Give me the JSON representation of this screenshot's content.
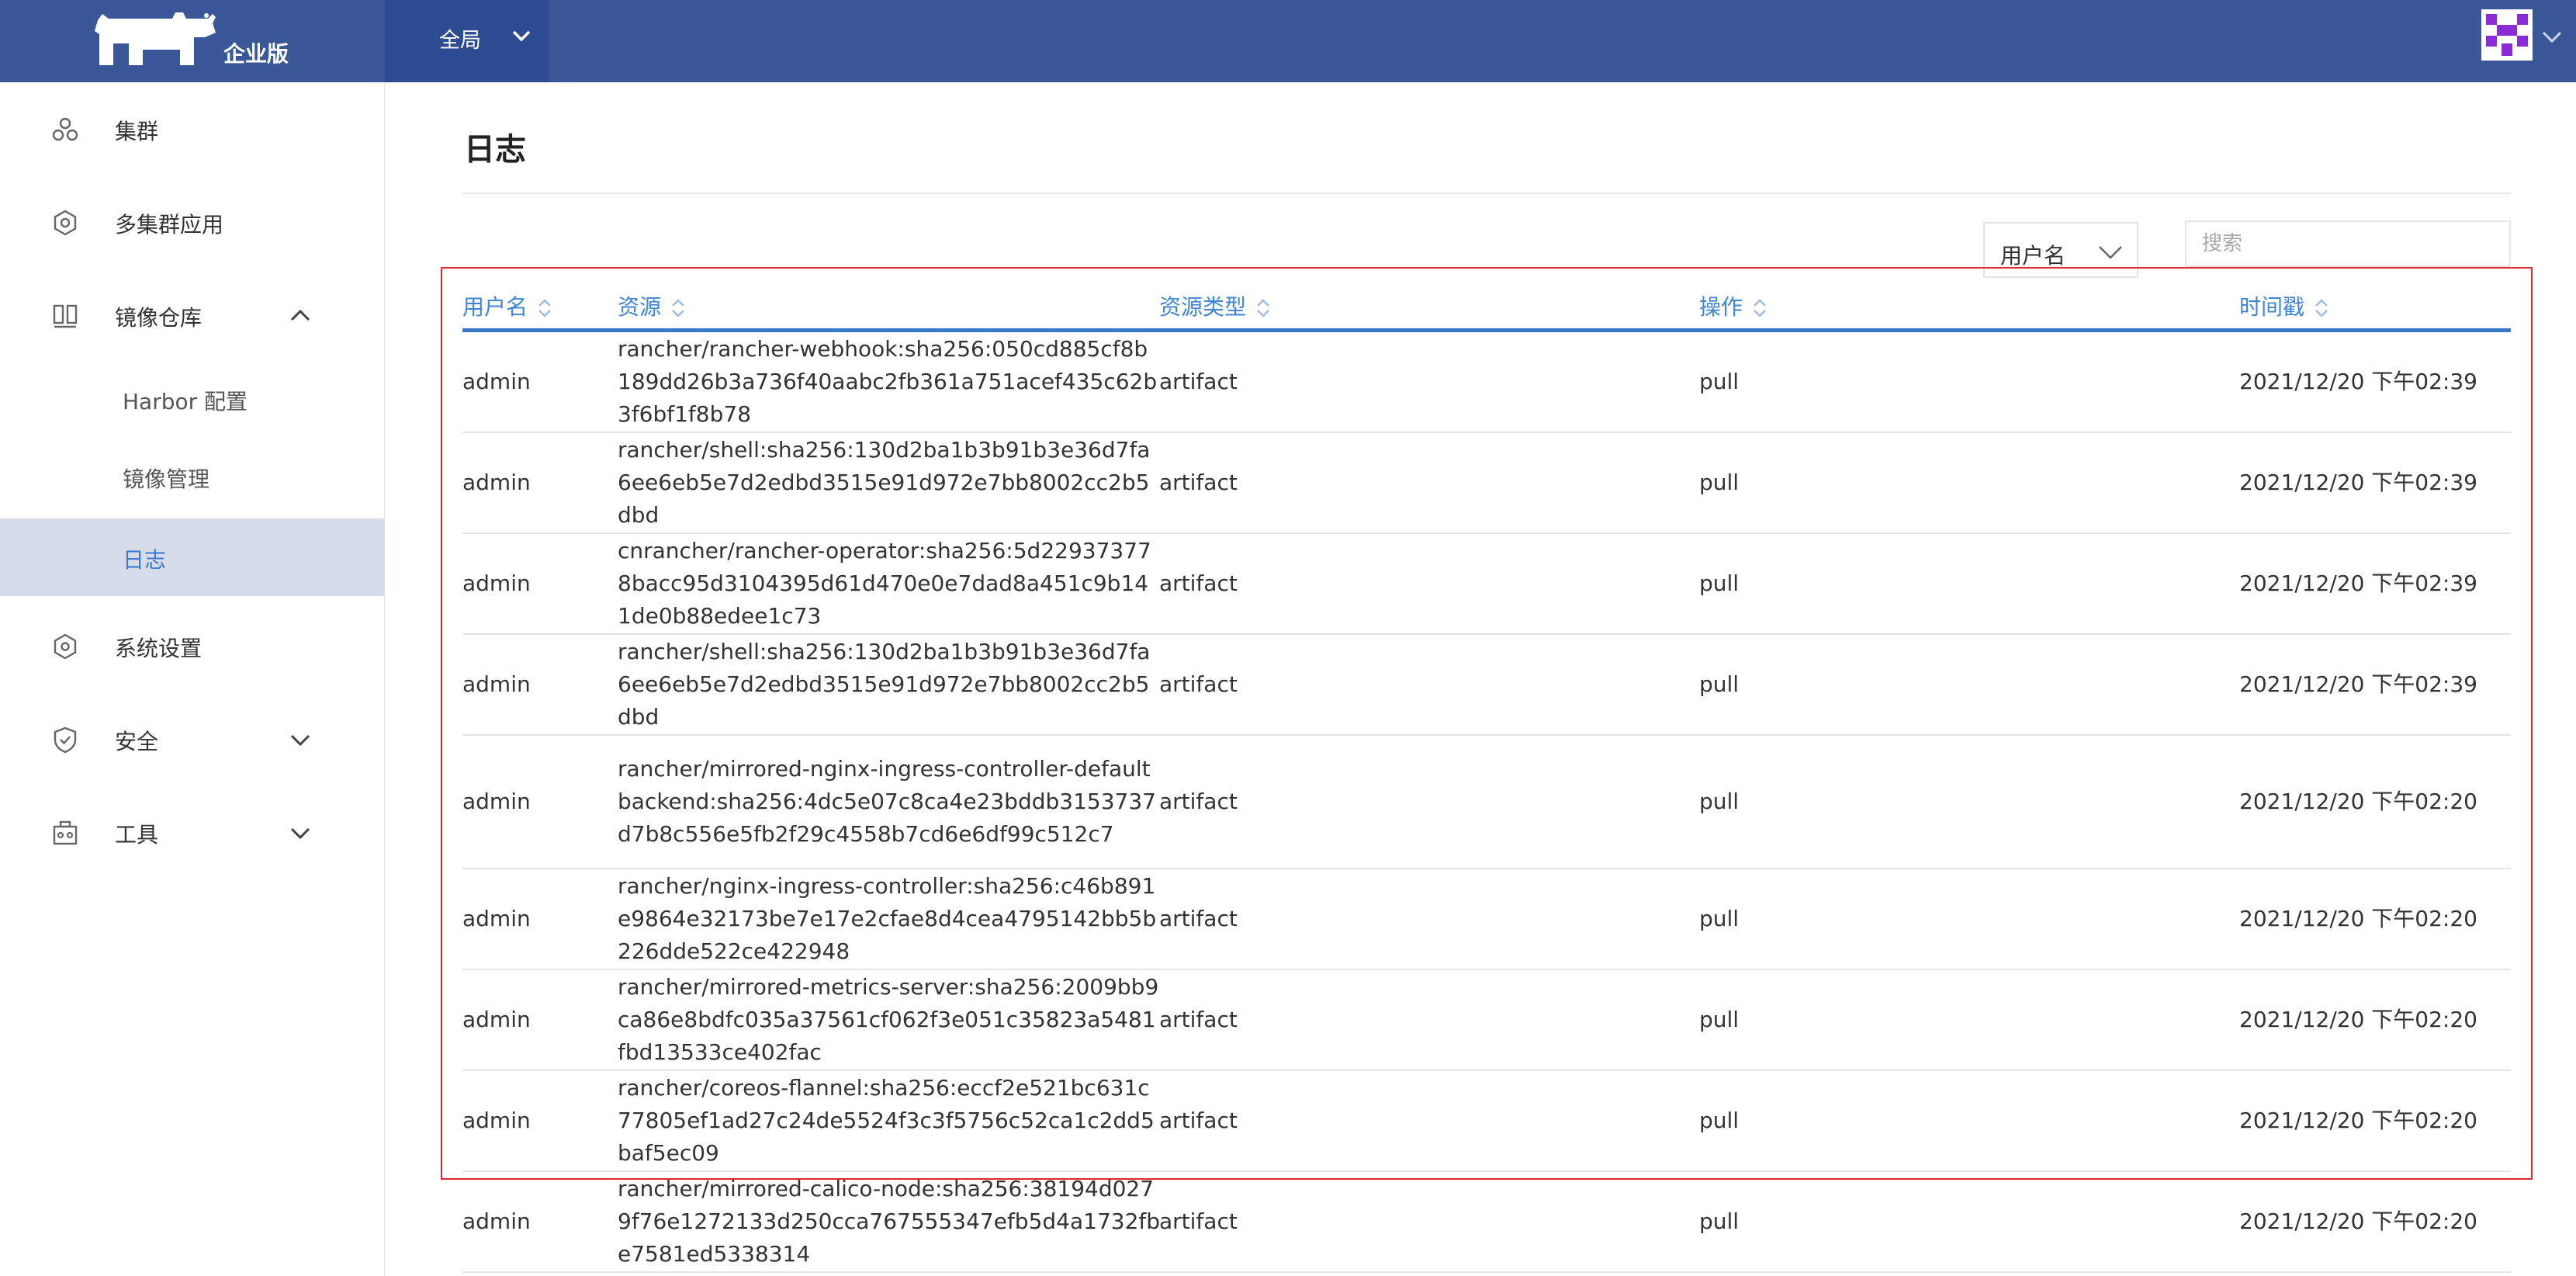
{
  "header": {
    "edition": "企业版",
    "scope_label": "全局"
  },
  "sidebar": {
    "items": [
      {
        "label": "集群"
      },
      {
        "label": "多集群应用"
      },
      {
        "label": "镜像仓库"
      },
      {
        "label": "系统设置"
      },
      {
        "label": "安全"
      },
      {
        "label": "工具"
      }
    ],
    "registry_subitems": [
      {
        "label": "Harbor 配置"
      },
      {
        "label": "镜像管理"
      },
      {
        "label": "日志",
        "active": true
      }
    ]
  },
  "page": {
    "title": "日志",
    "filter_value": "用户名",
    "search_placeholder": "搜索"
  },
  "table": {
    "columns": [
      "用户名",
      "资源",
      "资源类型",
      "操作",
      "时间戳"
    ],
    "rows": [
      {
        "user": "admin",
        "resource": "rancher/rancher-webhook:sha256:050cd885cf8b189dd26b3a736f40aabc2fb361a751acef435c62b3f6bf1f8b78",
        "type": "artifact",
        "op": "pull",
        "time": "2021/12/20 下午02:39"
      },
      {
        "user": "admin",
        "resource": "rancher/shell:sha256:130d2ba1b3b91b3e36d7fa6ee6eb5e7d2edbd3515e91d972e7bb8002cc2b5dbd",
        "type": "artifact",
        "op": "pull",
        "time": "2021/12/20 下午02:39"
      },
      {
        "user": "admin",
        "resource": "cnrancher/rancher-operator:sha256:5d229373778bacc95d3104395d61d470e0e7dad8a451c9b141de0b88edee1c73",
        "type": "artifact",
        "op": "pull",
        "time": "2021/12/20 下午02:39"
      },
      {
        "user": "admin",
        "resource": "rancher/shell:sha256:130d2ba1b3b91b3e36d7fa6ee6eb5e7d2edbd3515e91d972e7bb8002cc2b5dbd",
        "type": "artifact",
        "op": "pull",
        "time": "2021/12/20 下午02:39"
      },
      {
        "user": "admin",
        "resource": "rancher/mirrored-nginx-ingress-controller-defaultbackend:sha256:4dc5e07c8ca4e23bddb3153737d7b8c556e5fb2f29c4558b7cd6e6df99c512c7",
        "type": "artifact",
        "op": "pull",
        "time": "2021/12/20 下午02:20"
      },
      {
        "user": "admin",
        "resource": "rancher/nginx-ingress-controller:sha256:c46b891e9864e32173be7e17e2cfae8d4cea4795142bb5b226dde522ce422948",
        "type": "artifact",
        "op": "pull",
        "time": "2021/12/20 下午02:20"
      },
      {
        "user": "admin",
        "resource": "rancher/mirrored-metrics-server:sha256:2009bb9ca86e8bdfc035a37561cf062f3e051c35823a5481fbd13533ce402fac",
        "type": "artifact",
        "op": "pull",
        "time": "2021/12/20 下午02:20"
      },
      {
        "user": "admin",
        "resource": "rancher/coreos-flannel:sha256:eccf2e521bc631c77805ef1ad27c24de5524f3c3f5756c52ca1c2dd5baf5ec09",
        "type": "artifact",
        "op": "pull",
        "time": "2021/12/20 下午02:20"
      },
      {
        "user": "admin",
        "resource": "rancher/mirrored-calico-node:sha256:38194d0279f76e1272133d250cca767555347efb5d4a1732fbe7581ed5338314",
        "type": "artifact",
        "op": "pull",
        "time": "2021/12/20 下午02:20"
      }
    ]
  },
  "colors": {
    "header_bg": "#3a5797",
    "accent": "#3d86d8",
    "highlight": "#e0282e"
  }
}
